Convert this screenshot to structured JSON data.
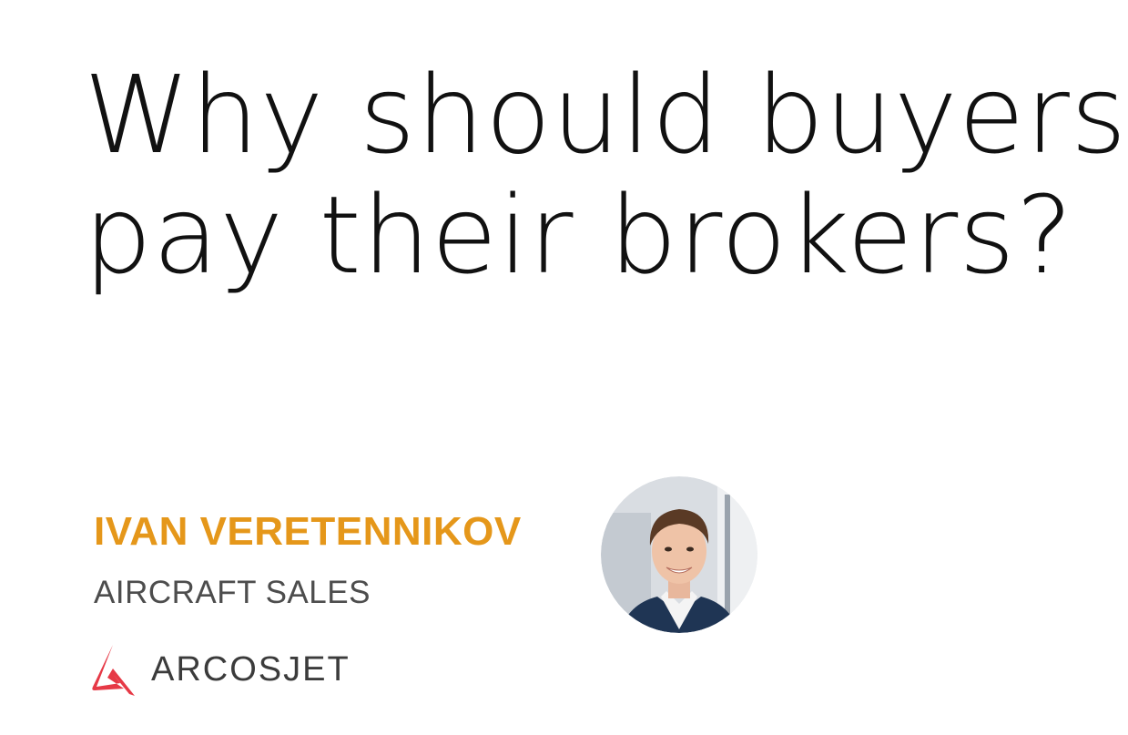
{
  "headline": {
    "line1": "Why should buyers",
    "line2": "pay their brokers?"
  },
  "author": {
    "name": "IVAN VERETENNIKOV",
    "role": "AIRCRAFT SALES",
    "photo_icon": "person-portrait"
  },
  "brand": {
    "logo_icon": "arcosjet-logo-icon",
    "name": "ARCOSJET"
  },
  "colors": {
    "accent": "#E5971A",
    "logo_red": "#E63946",
    "text_dark": "#111111",
    "text_gray": "#4d4d4d"
  }
}
